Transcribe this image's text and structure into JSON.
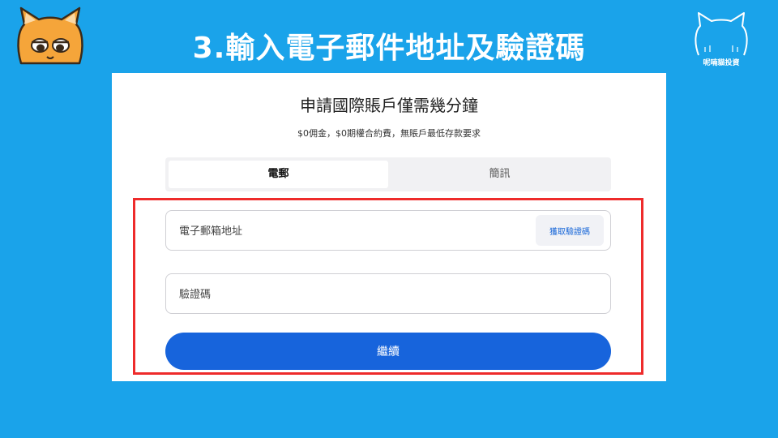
{
  "slide": {
    "title": "3.輸入電子郵件地址及驗證碼",
    "brand_label": "呢喃貓投資"
  },
  "form": {
    "heading": "申請國際賬戶僅需幾分鐘",
    "subheading": "$0佣金，$0期權合約費，無賬戶最低存款要求",
    "tabs": [
      {
        "label": "電郵",
        "active": true
      },
      {
        "label": "簡訊",
        "active": false
      }
    ],
    "email_placeholder": "電子郵箱地址",
    "get_code_label": "獲取驗證碼",
    "code_placeholder": "驗證碼",
    "continue_label": "繼續"
  },
  "colors": {
    "background": "#1aa3ea",
    "primary_button": "#1764dc",
    "highlight": "#ee2b2b",
    "cat_orange": "#f5a53a"
  },
  "icons": {
    "left_logo": "orange-cat-face-icon",
    "right_logo": "white-cat-outline-icon"
  }
}
